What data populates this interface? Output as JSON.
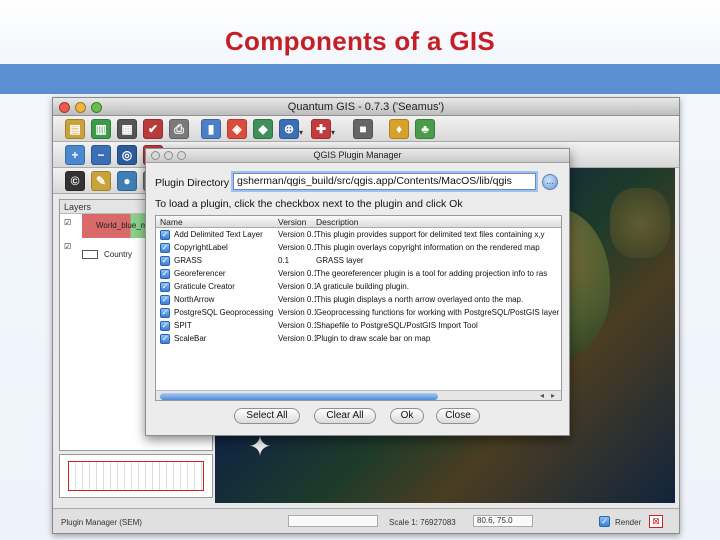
{
  "slide": {
    "title": "Components of a GIS"
  },
  "window": {
    "title": "Quantum GIS - 0.7.3 ('Seamus')"
  },
  "layers_panel": {
    "header": "Layers",
    "items": [
      {
        "label": "World_blue_m"
      },
      {
        "label": "Country"
      }
    ]
  },
  "statusbar": {
    "message": "Plugin Manager (SEM)",
    "scale": "Scale 1: 76927083",
    "coords": "80.6, 75.0",
    "render_label": "Render"
  },
  "dialog": {
    "title": "QGIS Plugin Manager",
    "dir_label": "Plugin Directory",
    "dir_value": "gsherman/qgis_build/src/qgis.app/Contents/MacOS/lib/qgis",
    "instruction": "To load a plugin, click the checkbox next to the plugin and click Ok",
    "columns": {
      "name": "Name",
      "version": "Version",
      "description": "Description"
    },
    "plugins": [
      {
        "name": "Add Delimited Text Layer",
        "version": "Version 0.1",
        "description": "This plugin provides support for delimited text files containing x,y"
      },
      {
        "name": "CopyrightLabel",
        "version": "Version 0.1",
        "description": "This plugin overlays copyright information on the rendered map"
      },
      {
        "name": "GRASS",
        "version": "0.1",
        "description": "GRASS layer"
      },
      {
        "name": "Georeferencer",
        "version": "Version 0.1",
        "description": "The georeferencer plugin is a tool for adding projection info to ras"
      },
      {
        "name": "Graticule Creator",
        "version": "Version 0.1",
        "description": "A graticule building plugin."
      },
      {
        "name": "NorthArrow",
        "version": "Version 0.1",
        "description": "This plugin displays a north arrow overlayed onto the map."
      },
      {
        "name": "PostgreSQL Geoprocessing",
        "version": "Version 0.1",
        "description": "Geoprocessing functions for working with PostgreSQL/PostGIS layer"
      },
      {
        "name": "SPIT",
        "version": "Version 0.1",
        "description": "Shapefile to PostgreSQL/PostGIS Import Tool"
      },
      {
        "name": "ScaleBar",
        "version": "Version 0.1",
        "description": "Plugin to draw scale bar on map"
      }
    ],
    "buttons": {
      "select_all": "Select All",
      "clear_all": "Clear All",
      "ok": "Ok",
      "close": "Close"
    }
  },
  "colors": {
    "title_red": "#c41f26",
    "band_blue": "#5b8fd3"
  }
}
